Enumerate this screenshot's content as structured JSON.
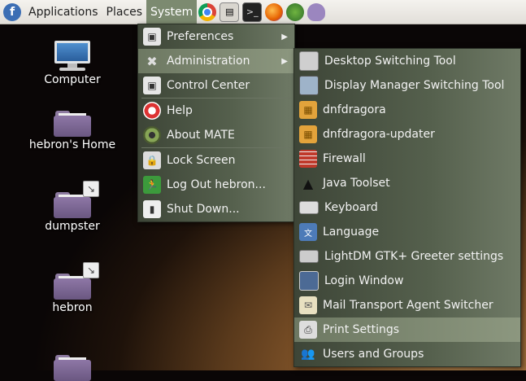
{
  "panel": {
    "menus": [
      "Applications",
      "Places",
      "System"
    ],
    "launchers": [
      "chrome-icon",
      "file-manager-icon",
      "terminal-icon",
      "firefox-icon",
      "lollypop-icon",
      "pidgin-icon"
    ]
  },
  "desktop": {
    "icons": [
      {
        "label": "Computer"
      },
      {
        "label": "hebron's Home"
      },
      {
        "label": "dumpster"
      },
      {
        "label": "hebron"
      }
    ]
  },
  "system_menu": {
    "items": [
      {
        "label": "Preferences",
        "icon": "preferences-icon",
        "submenu": true
      },
      {
        "label": "Administration",
        "icon": "administration-icon",
        "submenu": true
      },
      {
        "label": "Control Center",
        "icon": "control-center-icon"
      },
      {
        "label": "Help",
        "icon": "help-icon"
      },
      {
        "label": "About MATE",
        "icon": "mate-icon"
      },
      {
        "label": "Lock Screen",
        "icon": "lock-screen-icon"
      },
      {
        "label": "Log Out hebron...",
        "icon": "logout-icon"
      },
      {
        "label": "Shut Down...",
        "icon": "shutdown-icon"
      }
    ]
  },
  "admin_menu": {
    "items": [
      {
        "label": "Desktop Switching Tool"
      },
      {
        "label": "Display Manager Switching Tool"
      },
      {
        "label": "dnfdragora"
      },
      {
        "label": "dnfdragora-updater"
      },
      {
        "label": "Firewall"
      },
      {
        "label": "Java Toolset"
      },
      {
        "label": "Keyboard"
      },
      {
        "label": "Language"
      },
      {
        "label": "LightDM GTK+ Greeter settings"
      },
      {
        "label": "Login Window"
      },
      {
        "label": "Mail Transport Agent Switcher"
      },
      {
        "label": "Print Settings"
      },
      {
        "label": "Users and Groups"
      }
    ]
  },
  "colors": {
    "menu_bg": "#4a5343",
    "highlight": "#8c977f",
    "panel_active": "#7c8a70"
  }
}
